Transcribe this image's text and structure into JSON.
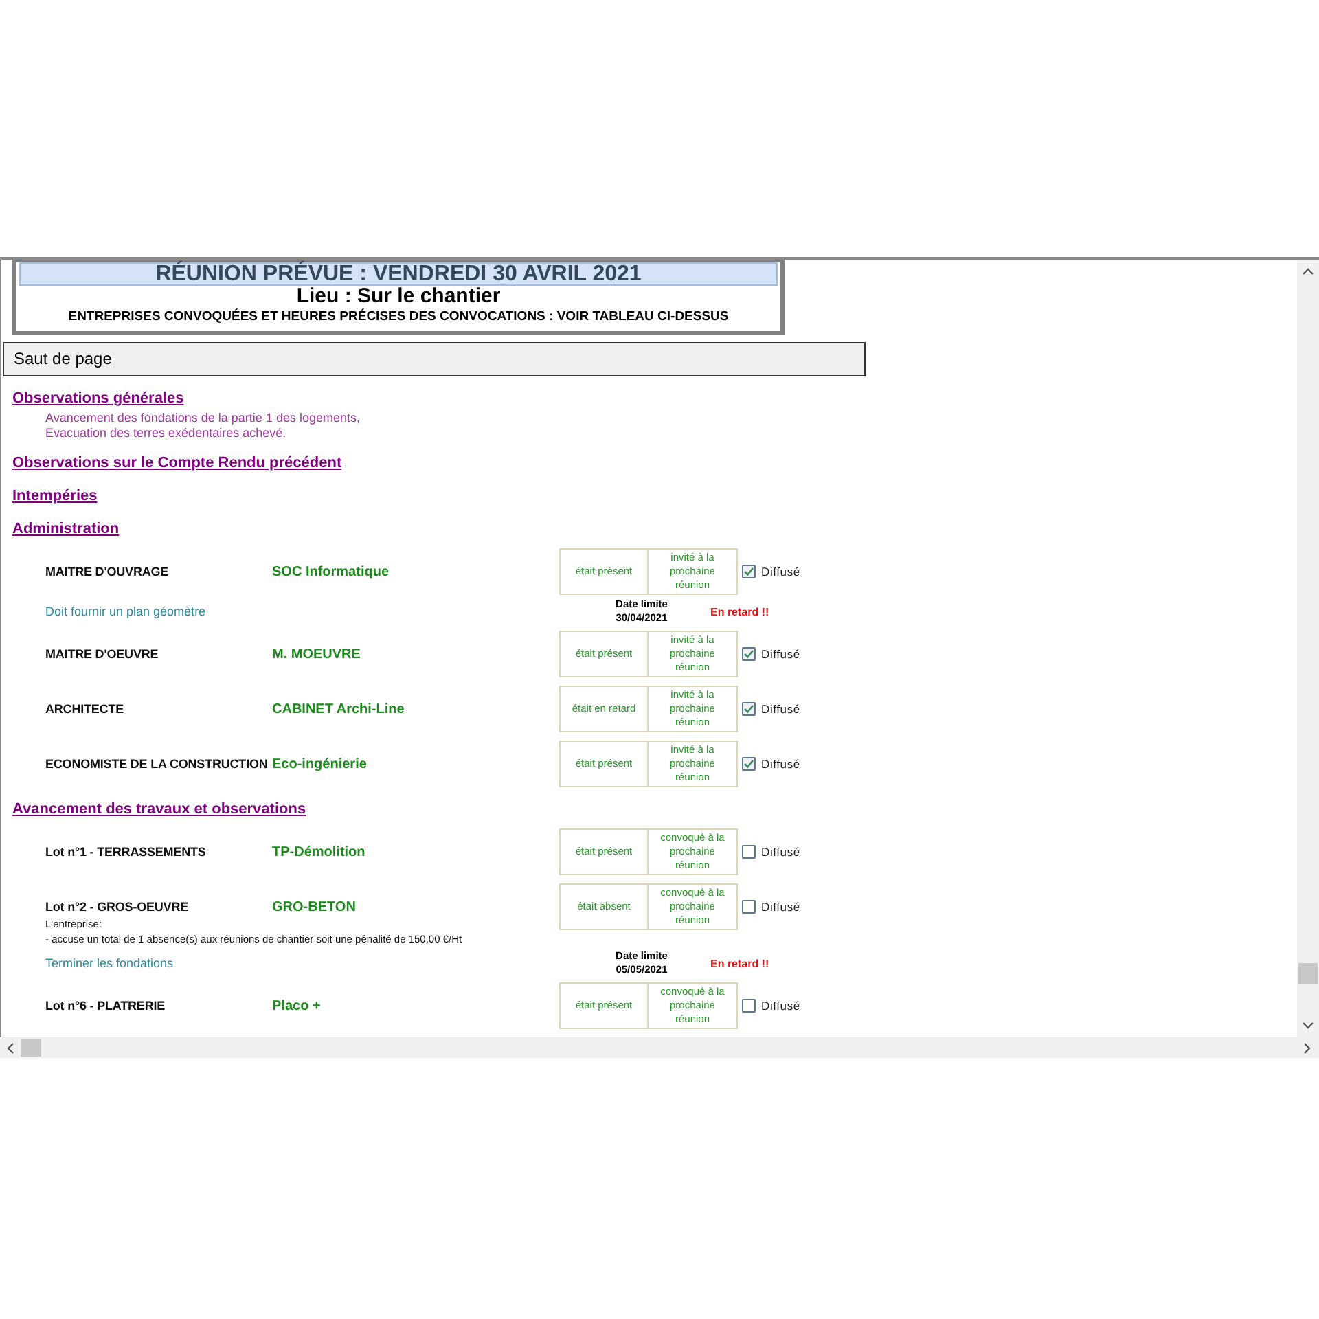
{
  "header": {
    "title": "RÉUNION PRÉVUE : VENDREDI 30 AVRIL 2021",
    "location": "Lieu : Sur le chantier",
    "subtitle": "ENTREPRISES CONVOQUÉES ET HEURES PRÉCISES DES CONVOCATIONS : VOIR TABLEAU CI-DESSUS"
  },
  "page_break": {
    "label": "Saut de page"
  },
  "sections": [
    {
      "title": "Observations générales",
      "lines": [
        "Avancement des fondations de la partie 1 des logements,",
        "Evacuation des terres exédentaires achevé."
      ]
    },
    {
      "title": "Observations sur le Compte Rendu précédent"
    },
    {
      "title": "Intempéries"
    },
    {
      "title": "Administration",
      "participants": [
        {
          "role": "MAITRE D'OUVRAGE",
          "company": "SOC Informatique",
          "attendance": "était présent",
          "invitation": "invité à la prochaine réunion",
          "checked": true,
          "checkbox_label": "Diffusé",
          "task": {
            "text": "Doit fournir un plan géomètre",
            "deadline_label": "Date limite",
            "deadline_date": "30/04/2021",
            "status": "En retard !!"
          }
        },
        {
          "role": "MAITRE D'OEUVRE",
          "company": "M. MOEUVRE",
          "attendance": "était présent",
          "invitation": "invité à la prochaine réunion",
          "checked": true,
          "checkbox_label": "Diffusé"
        },
        {
          "role": "ARCHITECTE",
          "company": "CABINET Archi-Line",
          "attendance": "était en retard",
          "invitation": "invité à la prochaine réunion",
          "checked": true,
          "checkbox_label": "Diffusé"
        },
        {
          "role": "ECONOMISTE DE LA CONSTRUCTION",
          "company": "Eco-ingénierie",
          "attendance": "était présent",
          "invitation": "invité à la prochaine réunion",
          "checked": true,
          "checkbox_label": "Diffusé"
        }
      ]
    },
    {
      "title": "Avancement des travaux et observations",
      "participants": [
        {
          "role": "Lot n°1 - TERRASSEMENTS",
          "company": "TP-Démolition",
          "attendance": "était présent",
          "invitation": "convoqué à la prochaine réunion",
          "checked": false,
          "checkbox_label": "Diffusé"
        },
        {
          "role": "Lot n°2 - GROS-OEUVRE",
          "company": "GRO-BETON",
          "attendance": "était absent",
          "invitation": "convoqué à la prochaine réunion",
          "checked": false,
          "checkbox_label": "Diffusé",
          "remarks": [
            "L'entreprise:",
            "- accuse un total de 1 absence(s) aux réunions de chantier soit une pénalité de 150,00 €/Ht"
          ],
          "task": {
            "text": "Terminer les fondations",
            "deadline_label": "Date limite",
            "deadline_date": "05/05/2021",
            "status": "En retard !!"
          }
        },
        {
          "role": "Lot n°6 - PLATRERIE",
          "company": "Placo +",
          "attendance": "était présent",
          "invitation": "convoqué à la prochaine réunion",
          "checked": false,
          "checkbox_label": "Diffusé"
        }
      ]
    }
  ]
}
